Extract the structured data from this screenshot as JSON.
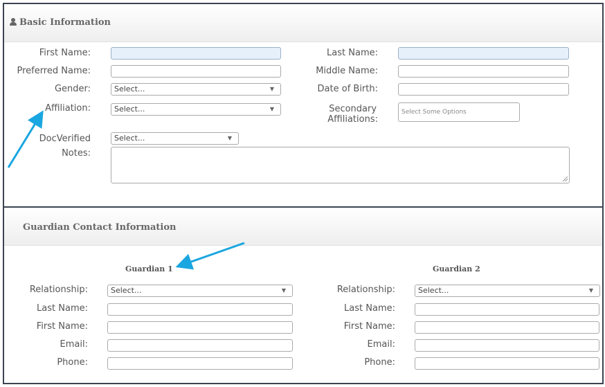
{
  "basic": {
    "title": "Basic Information",
    "first_name_label": "First Name:",
    "last_name_label": "Last Name:",
    "preferred_name_label": "Preferred Name:",
    "middle_name_label": "Middle Name:",
    "gender_label": "Gender:",
    "gender_value": "Select...",
    "dob_label": "Date of Birth:",
    "affiliation_label": "Affiliation:",
    "affiliation_value": "Select...",
    "secondary_label_line1": "Secondary",
    "secondary_label_line2": "Affiliations:",
    "secondary_placeholder": "Select Some Options",
    "docverified_label": "DocVerified",
    "docverified_value": "Select...",
    "notes_label": "Notes:"
  },
  "guardian": {
    "title": "Guardian Contact Information",
    "g1": {
      "heading": "Guardian 1",
      "relationship_label": "Relationship:",
      "relationship_value": "Select...",
      "last_name_label": "Last Name:",
      "first_name_label": "First Name:",
      "email_label": "Email:",
      "phone_label": "Phone:"
    },
    "g2": {
      "heading": "Guardian 2",
      "relationship_label": "Relationship:",
      "relationship_value": "Select...",
      "last_name_label": "Last Name:",
      "first_name_label": "First Name:",
      "email_label": "Email:",
      "phone_label": "Phone:"
    }
  },
  "colors": {
    "arrow": "#1aa6e0",
    "border": "#3c4350",
    "focus_fill": "#e6f0fb"
  },
  "icons": {
    "section": "user-icon",
    "annotation": "arrow-annotation-icon"
  }
}
